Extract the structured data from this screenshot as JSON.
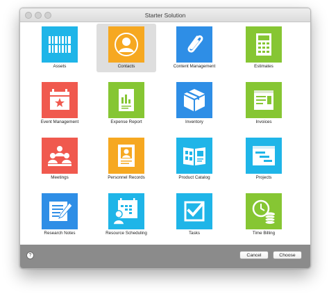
{
  "window": {
    "title": "Starter Solution"
  },
  "solutions": [
    {
      "label": "Assets",
      "icon": "barcode-icon",
      "color": "#1fb5e8"
    },
    {
      "label": "Contacts",
      "icon": "person-icon",
      "color": "#f6a821",
      "selected": true
    },
    {
      "label": "Content Management",
      "icon": "paperclip-icon",
      "color": "#2e8ee6"
    },
    {
      "label": "Estimates",
      "icon": "calculator-icon",
      "color": "#86c633"
    },
    {
      "label": "Event Management",
      "icon": "calendar-star-icon",
      "color": "#f0594e"
    },
    {
      "label": "Expense Report",
      "icon": "report-chart-icon",
      "color": "#86c633"
    },
    {
      "label": "Inventory",
      "icon": "box-icon",
      "color": "#2e8ee6"
    },
    {
      "label": "Invoices",
      "icon": "invoice-icon",
      "color": "#86c633"
    },
    {
      "label": "Meetings",
      "icon": "people-icon",
      "color": "#f0594e"
    },
    {
      "label": "Personnel Records",
      "icon": "id-card-icon",
      "color": "#f6a821"
    },
    {
      "label": "Product Catalog",
      "icon": "catalog-icon",
      "color": "#1fb5e8"
    },
    {
      "label": "Projects",
      "icon": "project-list-icon",
      "color": "#1fb5e8"
    },
    {
      "label": "Research Notes",
      "icon": "notes-pencil-icon",
      "color": "#2e8ee6"
    },
    {
      "label": "Resource Scheduling",
      "icon": "schedule-person-icon",
      "color": "#1fb5e8"
    },
    {
      "label": "Tasks",
      "icon": "checkmark-icon",
      "color": "#1fb5e8"
    },
    {
      "label": "Time Billing",
      "icon": "clock-coins-icon",
      "color": "#86c633"
    }
  ],
  "footer": {
    "help_label": "?",
    "cancel_label": "Cancel",
    "choose_label": "Choose"
  }
}
